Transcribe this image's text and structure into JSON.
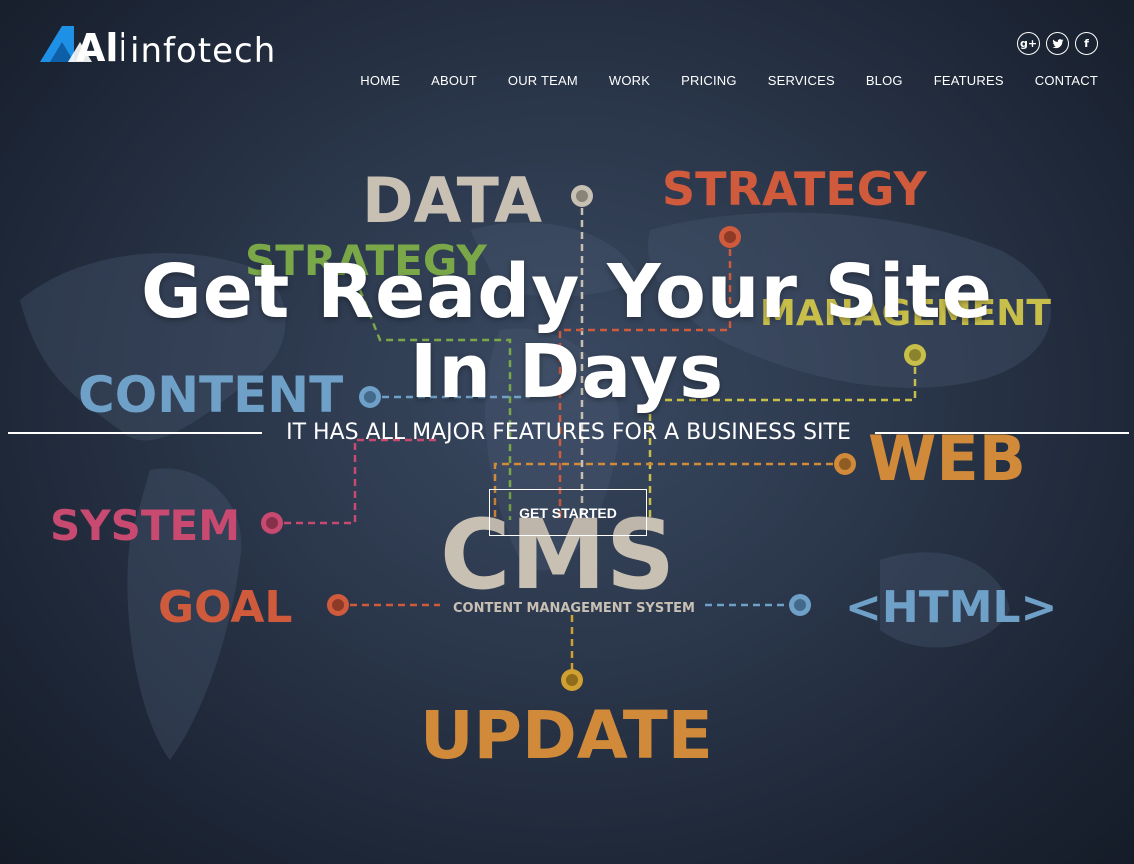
{
  "brand": {
    "mark": "Ali",
    "name": "infotech",
    "accent": "#1e90e6"
  },
  "social": [
    {
      "icon": "google-plus-icon",
      "glyph": "g+"
    },
    {
      "icon": "twitter-icon",
      "glyph": "t"
    },
    {
      "icon": "facebook-icon",
      "glyph": "f"
    }
  ],
  "nav": [
    "HOME",
    "ABOUT",
    "OUR TEAM",
    "WORK",
    "PRICING",
    "SERVICES",
    "BLOG",
    "FEATURES",
    "CONTACT"
  ],
  "hero": {
    "headline_line1": "Get Ready Your Site",
    "headline_line2": "In Days",
    "subtitle": "IT HAS ALL MAJOR FEATURES FOR A BUSINESS SITE",
    "cta_label": "GET STARTED"
  },
  "background_words": {
    "data": "DATA",
    "strategy_top": "STRATEGY",
    "strategy_green": "STRATEGY",
    "management": "MANAGEMENT",
    "content": "CONTENT",
    "web": "WEB",
    "system": "SYSTEM",
    "cms": "CMS",
    "cms_caption": "CONTENT MANAGEMENT SYSTEM",
    "goal": "GOAL",
    "html": "<HTML>",
    "update": "UPDATE"
  }
}
